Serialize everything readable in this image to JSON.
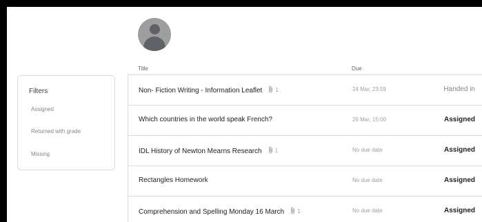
{
  "avatar": {
    "icon": "account-circle-icon"
  },
  "columns": {
    "title": "Title",
    "due": "Due"
  },
  "filters": {
    "heading": "Filters",
    "options": [
      "Assigned",
      "Returned with grade",
      "Missing"
    ]
  },
  "assignments": [
    {
      "title": "Non- Fiction Writing - Information Leaflet",
      "attachments": "1",
      "due": "24 Mar, 23:59",
      "status": "Handed in"
    },
    {
      "title": "Which countries in the world speak French?",
      "attachments": "",
      "due": "26 Mar, 15:00",
      "status": "Assigned"
    },
    {
      "title": "IDL History of Newton Mearns Research",
      "attachments": "1",
      "due": "No due date",
      "status": "Assigned"
    },
    {
      "title": "Rectangles Homework",
      "attachments": "",
      "due": "No due date",
      "status": "Assigned"
    },
    {
      "title": "Comprehension and Spelling Monday 16 March",
      "attachments": "1",
      "due": "No due date",
      "status": "Assigned"
    }
  ],
  "colors": {
    "border": "#dadce0",
    "muted": "#80868b",
    "text": "#202124",
    "avatar_bg": "#9e9e9e",
    "avatar_fg": "#5f6368"
  }
}
